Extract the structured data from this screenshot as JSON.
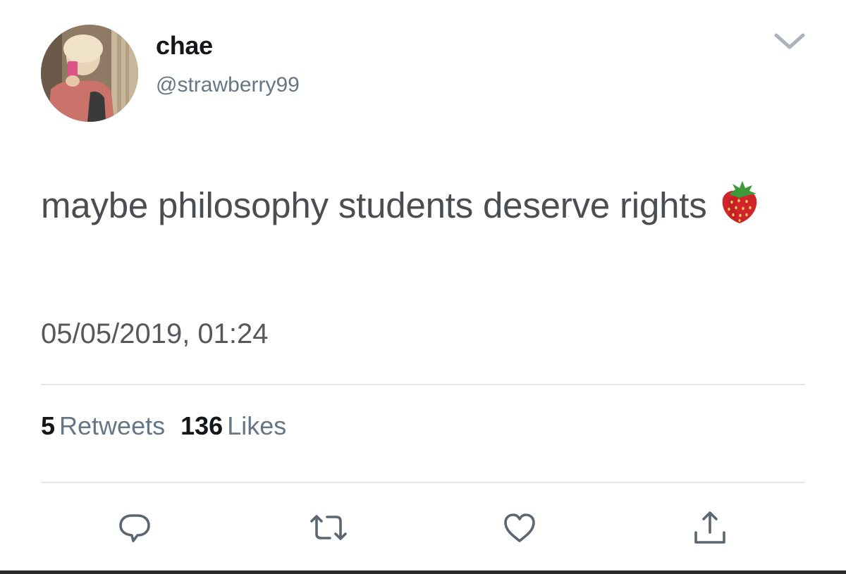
{
  "user": {
    "display_name": "chae",
    "handle": "@strawberry99"
  },
  "tweet": {
    "text": "maybe philosophy students deserve rights",
    "emoji": "strawberry-emoji",
    "timestamp": "05/05/2019, 01:24"
  },
  "stats": {
    "retweets_count": "5",
    "retweets_label": "Retweets",
    "likes_count": "136",
    "likes_label": "Likes"
  },
  "actions": [
    {
      "icon": "reply-icon"
    },
    {
      "icon": "retweet-icon"
    },
    {
      "icon": "heart-icon"
    },
    {
      "icon": "share-icon"
    }
  ],
  "colors": {
    "text_primary": "#14171a",
    "text_secondary": "#657786",
    "body_text": "#4a4e52",
    "divider": "#e1e8ed",
    "icon": "#5b6670"
  }
}
